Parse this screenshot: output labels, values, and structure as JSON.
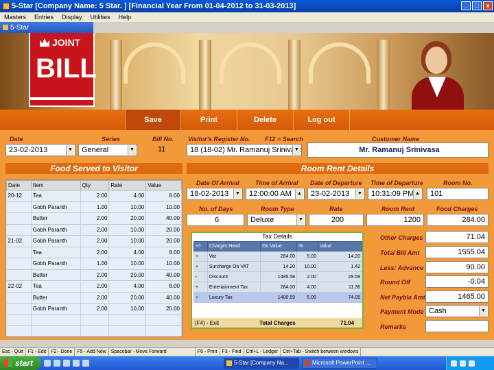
{
  "window": {
    "title": "5-Star [Company Name: 5 Star. ] [Financial Year From 01-04-2012 to 31-03-2013]"
  },
  "menu": [
    "Masters",
    "Entries",
    "Display",
    "Utilities",
    "Help"
  ],
  "child_window": {
    "title": "5-Star"
  },
  "logo": {
    "line1": "JOINT",
    "line2": "BILL"
  },
  "toolbar": {
    "save": "Save",
    "print": "Print",
    "delete": "Delete",
    "logout": "Log out"
  },
  "header": {
    "date_label": "Date",
    "date": "23-02-2013",
    "series_label": "Series",
    "series": "General",
    "bill_no_label": "Bill No.",
    "bill_no": "11",
    "register_label": "Visitor's Register No.",
    "register": "18 (18-02) Mr. Ramanuj Srinivasa",
    "search_label": "F12 = Search",
    "customer_label": "Customer Name",
    "customer": "Mr. Ramanuj Srinivasa"
  },
  "food": {
    "title": "Food Served to Visitor",
    "columns": [
      "Date",
      "Item",
      "Qty",
      "Rate",
      "Value"
    ],
    "rows": [
      [
        "20-12",
        "Tea",
        "2.00",
        "4.00",
        "8.00"
      ],
      [
        "",
        "Gobh Paranth",
        "1.00",
        "10.00",
        "10.00"
      ],
      [
        "",
        "Butter",
        "2.00",
        "20.00",
        "40.00"
      ],
      [
        "",
        "Gobh Paranth",
        "2.00",
        "10.00",
        "20.00"
      ],
      [
        "21-02",
        "Gobh Paranth",
        "2.00",
        "10.00",
        "20.00"
      ],
      [
        "",
        "Tea",
        "2.00",
        "4.00",
        "8.00"
      ],
      [
        "",
        "Gobh Paranth",
        "1.00",
        "10.00",
        "10.00"
      ],
      [
        "",
        "Butter",
        "2.00",
        "20.00",
        "40.00"
      ],
      [
        "22-02",
        "Tea",
        "2.00",
        "4.00",
        "8.00"
      ],
      [
        "",
        "Butter",
        "2.00",
        "20.00",
        "40.00"
      ],
      [
        "",
        "Gobh Paranth",
        "2.00",
        "10.00",
        "20.00"
      ],
      [
        "",
        "",
        "",
        "",
        ""
      ],
      [
        "",
        "",
        "",
        "",
        ""
      ]
    ]
  },
  "room": {
    "title": "Room Rent Details",
    "arrival_date_label": "Date Of Arrival",
    "arrival_date": "18-02-2013",
    "arrival_time_label": "Time of Arrival",
    "arrival_time": "12:00:00 AM",
    "departure_date_label": "Date of Departure",
    "departure_date": "23-02-2013",
    "departure_time_label": "Time of Departure",
    "departure_time": "10:31:09 PM",
    "room_no_label": "Room No.",
    "room_no": "101",
    "days_label": "No. of Days",
    "days": "6",
    "room_type_label": "Room Type",
    "room_type": "Deluxe",
    "rate_label": "Rate",
    "rate": "200",
    "room_rent_label": "Room Rent",
    "room_rent": "1200",
    "food_charges_label": "Food Charges",
    "food_charges": "284.00"
  },
  "tax": {
    "title": "Tax Details",
    "columns": [
      "+/-",
      "Charges Head",
      "On Value",
      "%",
      "Value"
    ],
    "rows": [
      [
        "+",
        "Vat",
        "284.00",
        "5.00",
        "14.20"
      ],
      [
        "+",
        "Surcharge On VAT",
        "14.20",
        "10.00",
        "1.42"
      ],
      [
        "-",
        "Discount",
        "1495.58",
        "2.00",
        "29.59"
      ],
      [
        "+",
        "Entertainment Tax",
        "284.00",
        "4.00",
        "11.36"
      ],
      [
        "+",
        "Luxury Tax",
        "1400.59",
        "5.00",
        "74.05"
      ]
    ],
    "footer_hint": "(F4) - Exit",
    "total_label": "Total Charges",
    "total": "71.04"
  },
  "summary": {
    "other_label": "Other Charges",
    "other": "71.04",
    "total_label": "Total Bill Amt",
    "total": "1555.04",
    "advance_label": "Less: Advance",
    "advance": "90.00",
    "roundoff_label": "Round Off",
    "roundoff": "-0.04",
    "net_label": "Net Paybla Amt",
    "net": "1465.00",
    "payment_label": "Payment Mode",
    "payment": "Cash",
    "remarks_label": "Remarks"
  },
  "statusbar": [
    "Esc - Quit",
    "F1 - Edit",
    "F2 - Done",
    "F5 - Add New",
    "Spacebar - Move Forward",
    "F6 - Print",
    "F3 - Find",
    "Ctrl+L - Ledger",
    "Ctrl+Tab - Switch between windows"
  ],
  "taskbar": {
    "start": "start",
    "tasks": [
      "5-Star [Company Na...",
      "Microsoft PowerPoint ..."
    ]
  }
}
